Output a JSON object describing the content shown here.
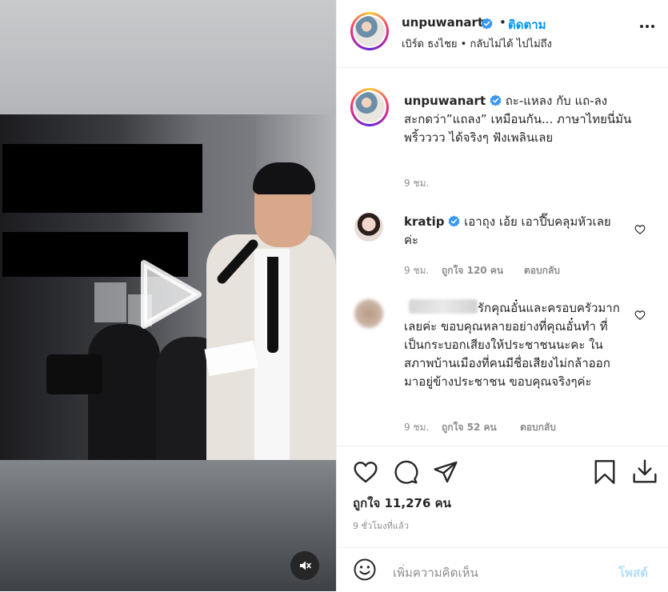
{
  "post": {
    "username": "unpuwanart",
    "follow_label": "ติดตาม",
    "separator": "•",
    "location": "เบิร์ด ธงไชย • กลับไม่ได้ ไปไม่ถึง"
  },
  "caption": {
    "username": "unpuwanart",
    "text": "ถะ-แหลง กับ แถ-ลง สะกดว่า”แถลง” เหมือนกัน... ภาษาไทยนี่มันพริ้วววว ได้จริงๆ ฟังเพลินเลย",
    "time": "9 ชม."
  },
  "comments": [
    {
      "username": "kratip",
      "verified": true,
      "text": "เอาถุง เอ้ย เอาปี๊บคลุมหัวเลยค่ะ",
      "time": "9 ชม.",
      "likes": "ถูกใจ 120 คน",
      "reply_label": "ตอบกลับ"
    },
    {
      "username": "",
      "verified": false,
      "text": "รักคุณอั๋นและครอบครัวมากเลยค่ะ ขอบคุณหลายอย่างที่คุณอั๋นทำ ที่เป็นกระบอกเสียงให้ประชาชนนะคะ ในสภาพบ้านเมืองที่คนมีชื่อเสียงไม่กล้าออกมาอยู่ข้างประชาชน ขอบคุณจริงๆค่ะ",
      "time": "9 ชม.",
      "likes": "ถูกใจ 52 คน",
      "reply_label": "ตอบกลับ"
    }
  ],
  "stats": {
    "likes": "ถูกใจ 11,276 คน",
    "time_ago": "9 ชั่วโมงที่แล้ว"
  },
  "composer": {
    "placeholder": "เพิ่มความคิดเห็น",
    "post_label": "โพสต์"
  },
  "icons": {
    "verified": "verified-badge-icon",
    "more": "more-options-icon",
    "like": "heart-icon",
    "comment": "comment-icon",
    "share": "share-icon",
    "save": "bookmark-icon",
    "download": "download-icon",
    "emoji": "emoji-icon",
    "play": "play-icon",
    "mute": "muted-speaker-icon"
  },
  "colors": {
    "link": "#0095f6",
    "post_disabled": "#b2dffc",
    "verified": "#3897f0",
    "text": "#262626",
    "muted": "#8e8e8e"
  }
}
